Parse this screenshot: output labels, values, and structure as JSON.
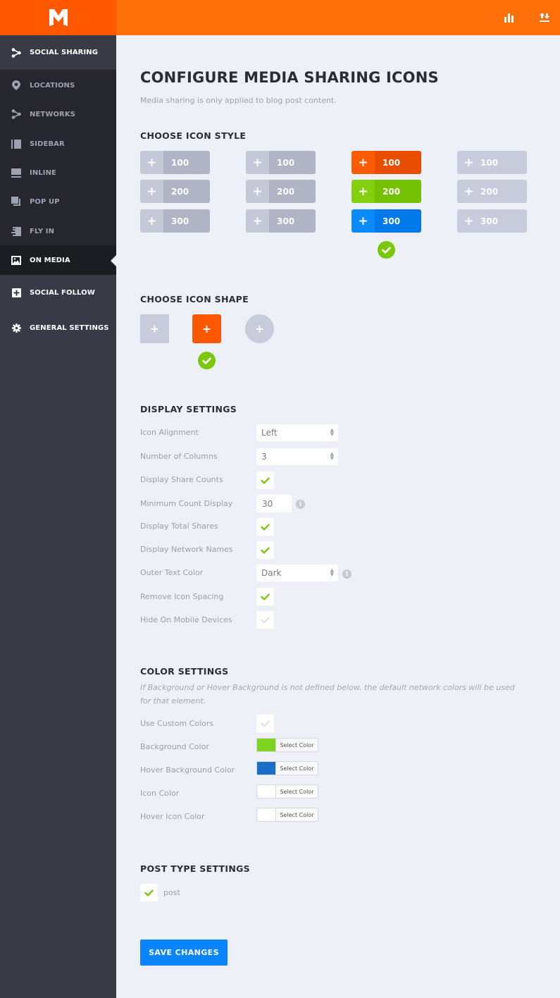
{
  "app": {
    "logo_letter": "M",
    "colors": {
      "brand_orange": "#ff5800",
      "topbar_orange": "#ff6f0a",
      "sidebar_dark": "#25262e",
      "sidebar_mid": "#383b45",
      "accent_green": "#7ac70c",
      "accent_blue": "#0a84ff"
    }
  },
  "topbar": {
    "icons": [
      {
        "name": "stats-bar-chart-icon"
      },
      {
        "name": "import-export-icon"
      }
    ]
  },
  "sidebar": {
    "items": [
      {
        "label": "SOCIAL SHARING",
        "icon": "share-network-icon",
        "state": "section"
      },
      {
        "label": "LOCATIONS",
        "icon": "location-pin-icon",
        "state": "sub"
      },
      {
        "label": "NETWORKS",
        "icon": "networks-icon",
        "state": "sub"
      },
      {
        "label": "SIDEBAR",
        "icon": "sidebar-layout-icon",
        "state": "sub"
      },
      {
        "label": "INLINE",
        "icon": "inline-layout-icon",
        "state": "sub"
      },
      {
        "label": "POP UP",
        "icon": "popup-layout-icon",
        "state": "sub"
      },
      {
        "label": "FLY IN",
        "icon": "fly-in-layout-icon",
        "state": "sub"
      },
      {
        "label": "ON MEDIA",
        "icon": "image-icon",
        "state": "active"
      },
      {
        "label": "SOCIAL FOLLOW",
        "icon": "plus-square-icon",
        "state": "section"
      },
      {
        "label": "GENERAL SETTINGS",
        "icon": "gear-icon",
        "state": "section"
      }
    ]
  },
  "main": {
    "title": "CONFIGURE MEDIA SHARING ICONS",
    "subtitle": "Media sharing is only applied to blog post content.",
    "icon_style": {
      "heading": "CHOOSE ICON STYLE",
      "selected_index": 2,
      "styles": [
        {
          "buttons": [
            {
              "label": "100",
              "plus_bg": "#c5c8d6",
              "num_bg": "#b0b4c4"
            },
            {
              "label": "200",
              "plus_bg": "#c5c8d6",
              "num_bg": "#b0b4c4"
            },
            {
              "label": "300",
              "plus_bg": "#c5c8d6",
              "num_bg": "#b0b4c4"
            }
          ]
        },
        {
          "buttons": [
            {
              "label": "100",
              "plus_bg": "#c5c8d6",
              "num_bg": "#b0b4c4"
            },
            {
              "label": "200",
              "plus_bg": "#c5c8d6",
              "num_bg": "#b0b4c4"
            },
            {
              "label": "300",
              "plus_bg": "#c5c8d6",
              "num_bg": "#b0b4c4"
            }
          ]
        },
        {
          "buttons": [
            {
              "label": "100",
              "plus_bg": "#ff5b00",
              "num_bg": "#e84d00"
            },
            {
              "label": "200",
              "plus_bg": "#84d00f",
              "num_bg": "#74c102"
            },
            {
              "label": "300",
              "plus_bg": "#0a8aff",
              "num_bg": "#0079eb"
            }
          ]
        },
        {
          "buttons": [
            {
              "label": "100",
              "plus_bg": "#c8cbdb",
              "num_bg": "#c8cbdb"
            },
            {
              "label": "200",
              "plus_bg": "#c8cbdb",
              "num_bg": "#c8cbdb"
            },
            {
              "label": "300",
              "plus_bg": "#c8cbdb",
              "num_bg": "#c8cbdb"
            }
          ]
        }
      ]
    },
    "icon_shape": {
      "heading": "CHOOSE ICON SHAPE",
      "selected_index": 1,
      "shapes": [
        {
          "name": "square",
          "color": "#c8cbdb",
          "glyph": "+"
        },
        {
          "name": "rounded",
          "color": "#ff5800",
          "glyph": "+"
        },
        {
          "name": "circle",
          "color": "#c8cbdb",
          "glyph": "+"
        }
      ]
    },
    "display_settings": {
      "heading": "DISPLAY SETTINGS",
      "icon_alignment": {
        "label": "Icon Alignment",
        "value": "Left"
      },
      "number_of_columns": {
        "label": "Number of Columns",
        "value": "3"
      },
      "display_share_counts": {
        "label": "Display Share Counts",
        "checked": true
      },
      "minimum_count_display": {
        "label": "Minimum Count Display",
        "value": "30"
      },
      "display_total_shares": {
        "label": "Display Total Shares",
        "checked": true
      },
      "display_network_names": {
        "label": "Display Network Names",
        "checked": true
      },
      "outer_text_color": {
        "label": "Outer Text Color",
        "value": "Dark"
      },
      "remove_icon_spacing": {
        "label": "Remove Icon Spacing",
        "checked": true
      },
      "hide_on_mobile": {
        "label": "Hide On Mobile Devices",
        "checked": false
      }
    },
    "color_settings": {
      "heading": "COLOR SETTINGS",
      "note": "If Background or Hover Background is not defined below, the default network colors will be used for that element.",
      "use_custom_colors": {
        "label": "Use Custom Colors",
        "checked": false
      },
      "pickers": [
        {
          "label": "Background Color",
          "color": "#7ed321",
          "button": "Select Color"
        },
        {
          "label": "Hover Background Color",
          "color": "#1a6dc9",
          "button": "Select Color"
        },
        {
          "label": "Icon Color",
          "color": "#ffffff",
          "button": "Select Color"
        },
        {
          "label": "Hover Icon Color",
          "color": "#ffffff",
          "button": "Select Color"
        }
      ]
    },
    "post_type_settings": {
      "heading": "POST TYPE SETTINGS",
      "types": [
        {
          "label": "post",
          "checked": true
        }
      ]
    },
    "save_label": "SAVE CHANGES"
  }
}
